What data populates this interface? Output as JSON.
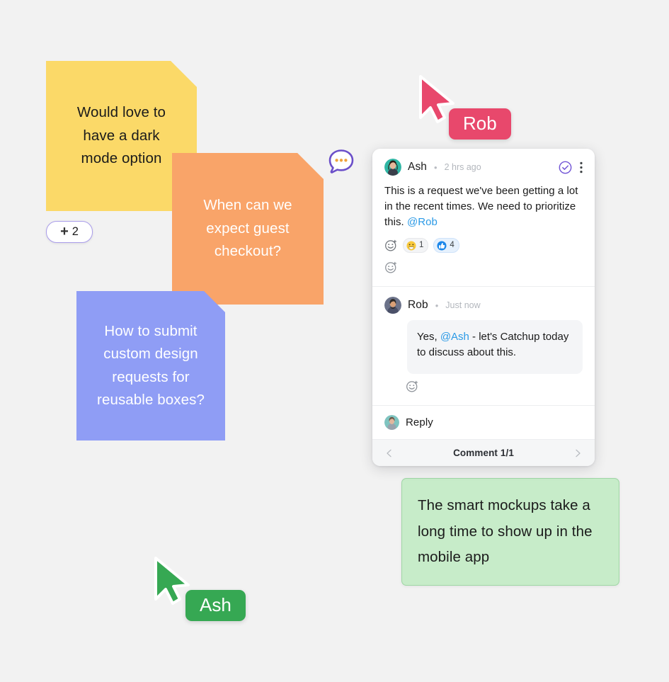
{
  "canvas": {
    "background": "#f2f2f2"
  },
  "notes": [
    {
      "id": "note-yellow",
      "text": "Would love to\nhave a dark\nmode option",
      "color": "#fbd968",
      "fold_color": "#fac84e",
      "text_color": "#1b1b1b"
    },
    {
      "id": "note-orange",
      "text": "When can we\nexpect guest\ncheckout?",
      "color": "#f9a469",
      "fold_color": "#f78f4a",
      "text_color": "#ffffff"
    },
    {
      "id": "note-blue",
      "text": "How to submit\ncustom design\nrequests for\nreusable boxes?",
      "color": "#8f9df5",
      "fold_color": "#7f8ef0",
      "text_color": "#ffffff"
    },
    {
      "id": "note-green",
      "text": "The smart mockups take a long time to show up in the mobile app",
      "color": "#c7ecc9",
      "border_color": "#9fd6a5",
      "text_color": "#1b1b1b"
    }
  ],
  "plus_badge": {
    "plus": "+",
    "count": "2",
    "border_color": "#a99cea"
  },
  "comment_pin": {
    "icon": "speech-bubble-icon",
    "outline_color": "#6b4fc9",
    "dot_color": "#f0a33c"
  },
  "cursors": [
    {
      "id": "cursor-rob",
      "name": "Rob",
      "color": "#e8486c"
    },
    {
      "id": "cursor-ash",
      "name": "Ash",
      "color": "#36a853"
    }
  ],
  "comment_card": {
    "resolve_icon": "check-circle-icon",
    "more_icon": "more-vertical-icon",
    "accent_color": "#7255d6",
    "messages": [
      {
        "author": "Ash",
        "separator": "•",
        "timestamp": "2 hrs ago",
        "body_before_mention": "This is a request we've been getting a lot in the recent times. We need to prioritize this. ",
        "mention": "@Rob",
        "body_after_mention": "",
        "reactions": [
          {
            "emoji": "grinning-face-emoji",
            "count": "1",
            "style": "yellow"
          },
          {
            "emoji": "thumbs-up-emoji",
            "count": "4",
            "style": "blue"
          }
        ],
        "add_reaction_icon": "add-reaction-icon"
      },
      {
        "author": "Rob",
        "separator": "•",
        "timestamp": "Just now",
        "body_before_mention": "Yes, ",
        "mention": "@Ash",
        "body_after_mention": " - let's Catchup today to discuss about this.",
        "add_reaction_icon": "add-reaction-icon"
      }
    ],
    "reply": {
      "placeholder": "Reply",
      "avatar": "ash-avatar"
    },
    "footer": {
      "prev_icon": "chevron-left-icon",
      "label": "Comment 1/1",
      "next_icon": "chevron-right-icon"
    }
  }
}
